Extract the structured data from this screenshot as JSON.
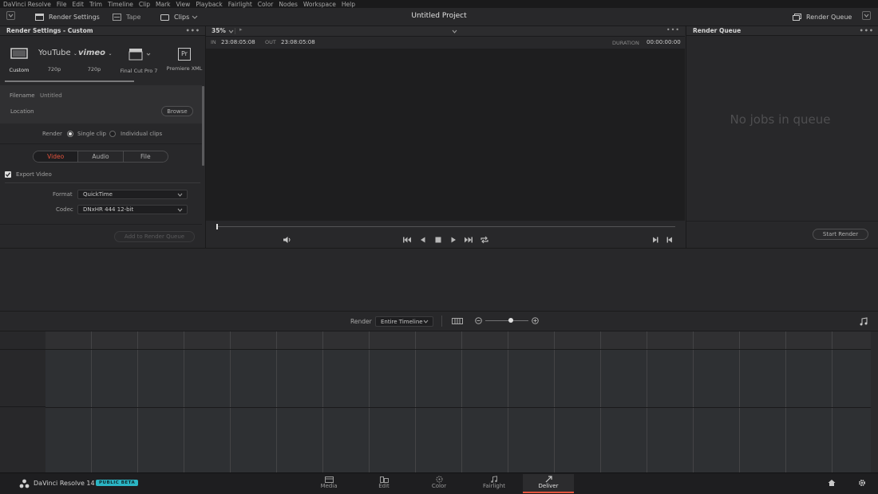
{
  "menu": [
    "DaVinci Resolve",
    "File",
    "Edit",
    "Trim",
    "Timeline",
    "Clip",
    "Mark",
    "View",
    "Playback",
    "Fairlight",
    "Color",
    "Nodes",
    "Workspace",
    "Help"
  ],
  "toolbar": {
    "render_settings": "Render Settings",
    "tape": "Tape",
    "clips": "Clips",
    "project_title": "Untitled Project",
    "render_queue": "Render Queue"
  },
  "render_settings": {
    "header": "Render Settings - Custom",
    "presets": [
      {
        "label": "Custom",
        "icon": "custom-monitor-icon"
      },
      {
        "label": "720p",
        "icon": "youtube-logo",
        "logo": "YouTube"
      },
      {
        "label": "720p",
        "icon": "vimeo-logo",
        "logo": "vimeo"
      },
      {
        "label": "Final Cut Pro 7",
        "icon": "clapperboard-icon"
      },
      {
        "label": "Premiere XML",
        "icon": "premiere-icon",
        "logo": "Pr"
      }
    ],
    "filename_label": "Filename",
    "filename_value": "Untitled",
    "location_label": "Location",
    "browse": "Browse",
    "render_label": "Render",
    "single_clip": "Single clip",
    "individual_clips": "Individual clips",
    "tabs": [
      "Video",
      "Audio",
      "File"
    ],
    "active_tab": "Video",
    "export_video": "Export Video",
    "format_label": "Format",
    "format_value": "QuickTime",
    "codec_label": "Codec",
    "codec_value": "DNxHR 444 12-bit",
    "add_to_queue": "Add to Render Queue"
  },
  "viewer": {
    "zoom": "35%",
    "in_label": "IN",
    "in_tc": "23:08:05:08",
    "out_label": "OUT",
    "out_tc": "23:08:05:08",
    "duration_label": "DURATION",
    "duration_tc": "00:00:00:00"
  },
  "queue": {
    "header": "Render Queue",
    "empty": "No jobs in queue",
    "start": "Start Render"
  },
  "timeline_bar": {
    "render_label": "Render",
    "range": "Entire Timeline"
  },
  "bottom": {
    "app": "DaVinci Resolve 14",
    "badge": "PUBLIC BETA",
    "pages": [
      {
        "label": "Media",
        "icon": "media-icon"
      },
      {
        "label": "Edit",
        "icon": "edit-icon"
      },
      {
        "label": "Color",
        "icon": "color-icon"
      },
      {
        "label": "Fairlight",
        "icon": "fairlight-icon"
      },
      {
        "label": "Deliver",
        "icon": "deliver-icon"
      }
    ],
    "active_page": "Deliver"
  },
  "colors": {
    "accent_red": "#e5533d",
    "badge": "#2bb5c4"
  }
}
